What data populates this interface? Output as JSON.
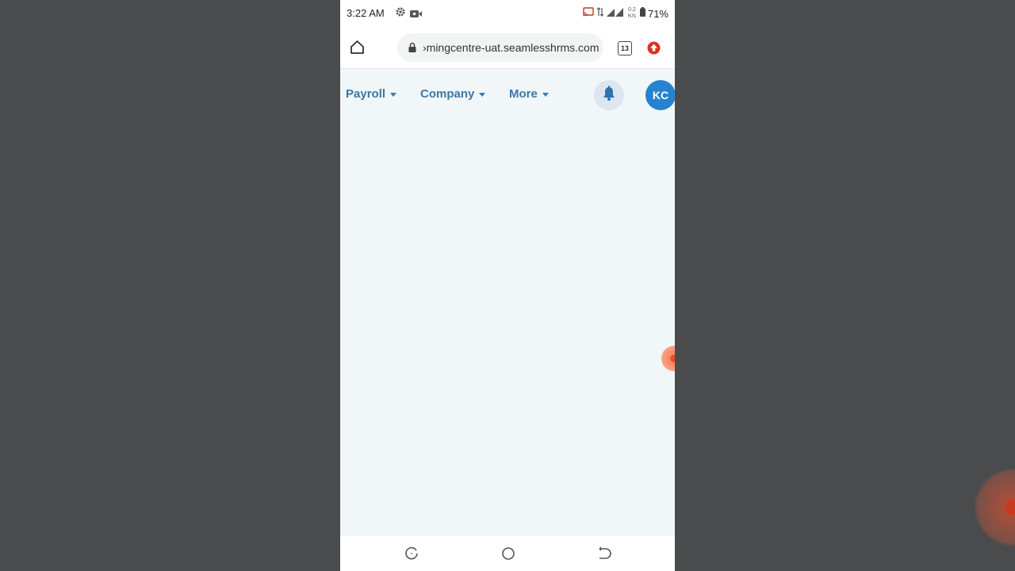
{
  "status_bar": {
    "time": "3:22 AM",
    "network_speed_value": "0.2",
    "network_speed_unit": "K/s",
    "battery_percent": "71%",
    "icons": [
      "gear-icon",
      "video-camera-icon",
      "cast-icon",
      "data-arrows-icon",
      "signal-icon",
      "battery-icon"
    ]
  },
  "browser": {
    "url": "›mingcentre-uat.seamlesshrms.com",
    "tab_count": "13",
    "icons": [
      "home-icon",
      "lock-icon",
      "tabs-icon",
      "extension-icon"
    ]
  },
  "nav": {
    "items": [
      {
        "label": "Payroll"
      },
      {
        "label": "Company"
      },
      {
        "label": "More"
      }
    ],
    "avatar_initials": "KC"
  },
  "colors": {
    "nav_text": "#3b79a5",
    "avatar_bg": "#2783cf",
    "page_bg": "#f1f6f9",
    "outer_bg": "#4a4b4d"
  },
  "android_nav": {
    "icons": [
      "recents-icon",
      "home-circle-icon",
      "back-icon"
    ]
  }
}
